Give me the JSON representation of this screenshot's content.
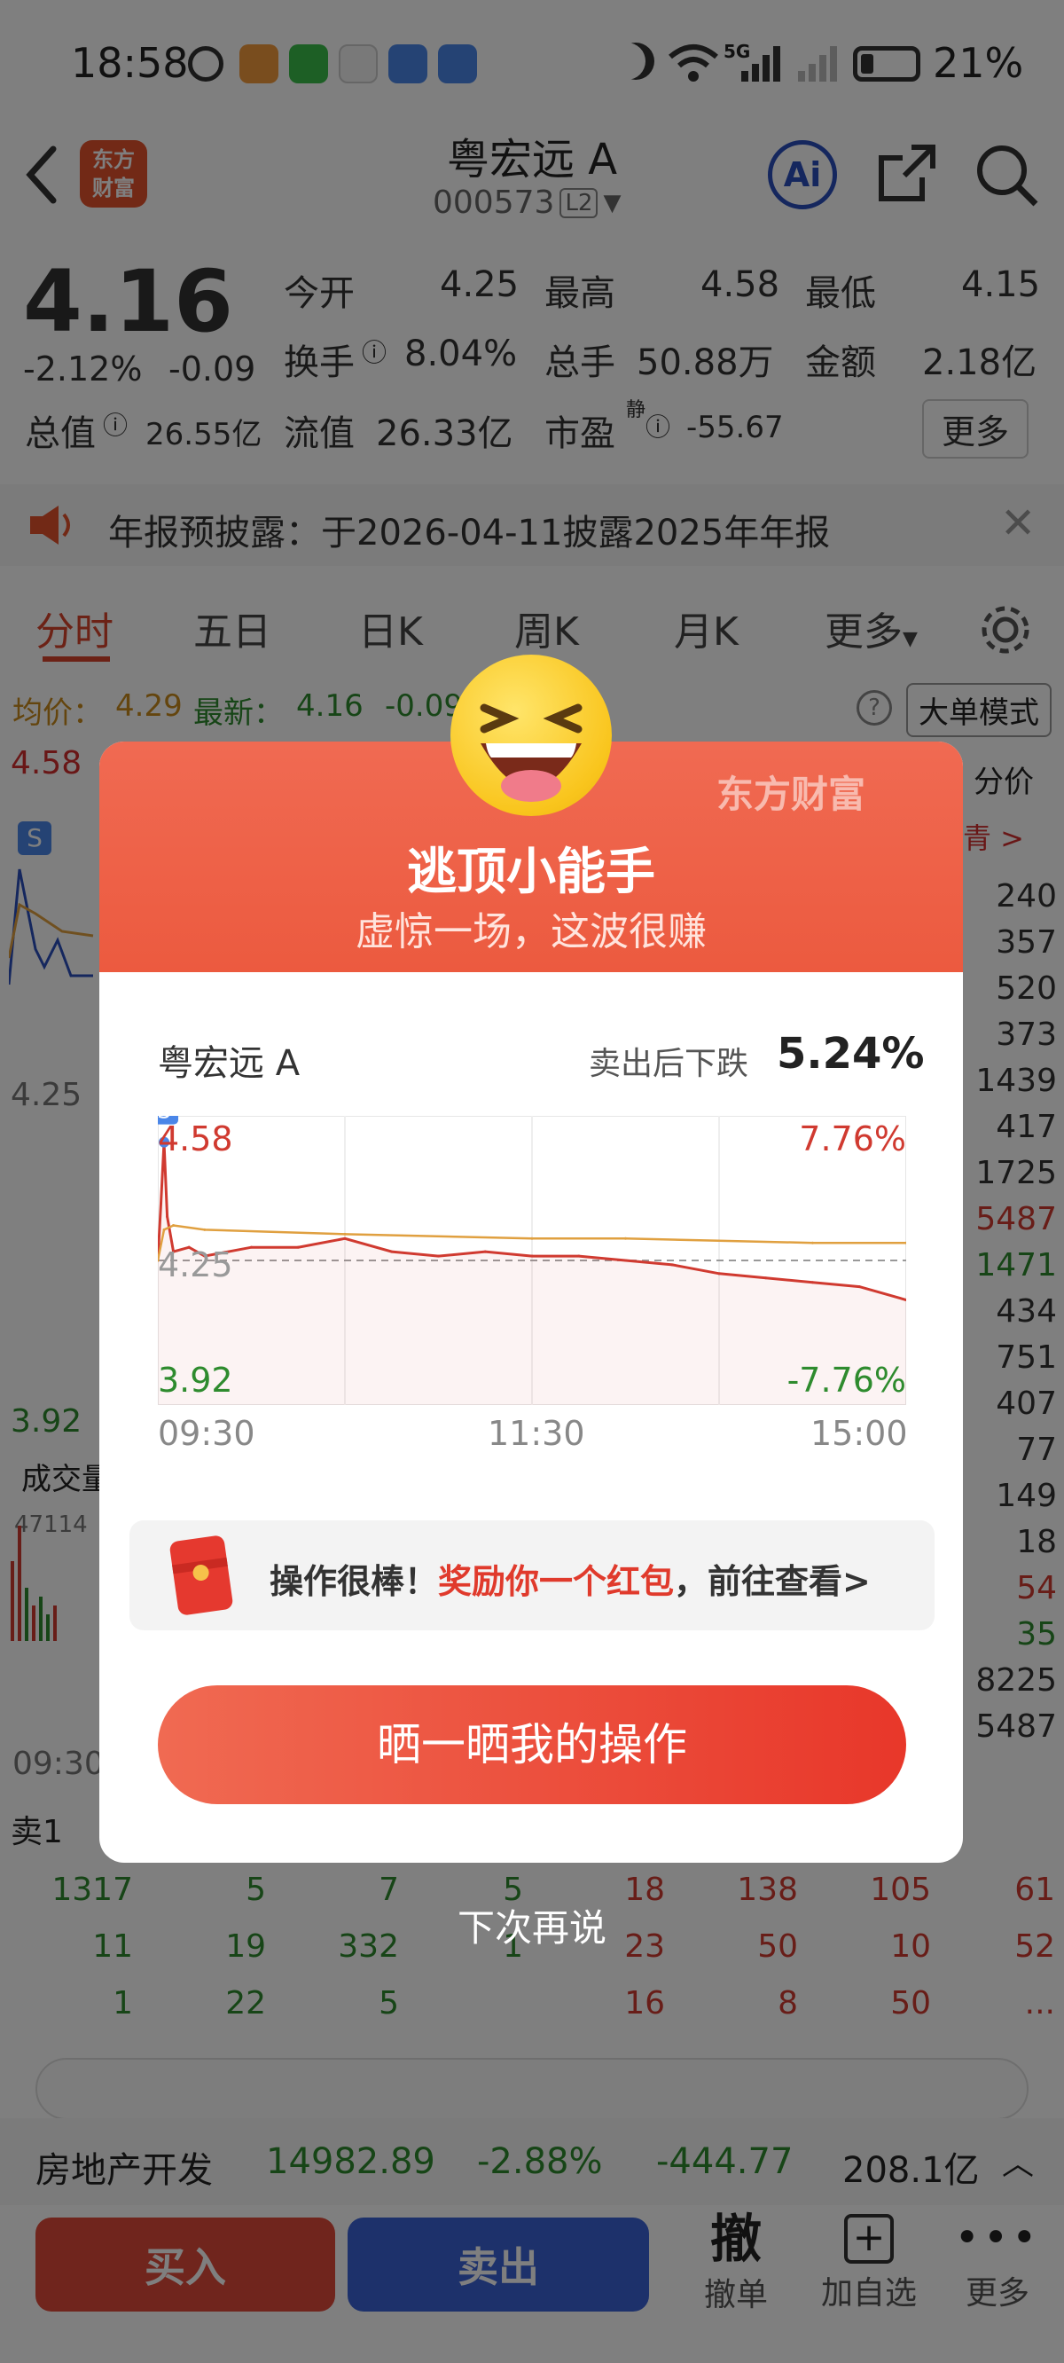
{
  "status_bar": {
    "time": "18:58",
    "network": "5G",
    "battery": "21%"
  },
  "header": {
    "stock_name": "粤宏远 A",
    "stock_code": "000573",
    "level": "L2",
    "ai_label": "Ai"
  },
  "quote": {
    "price": "4.16",
    "change_pct": "-2.12%",
    "change": "-0.09",
    "open_label": "今开",
    "open": "4.25",
    "high_label": "最高",
    "high": "4.58",
    "low_label": "最低",
    "low": "4.15",
    "turnover_label": "换手",
    "turnover": "8.04%",
    "volume_label": "总手",
    "volume": "50.88万",
    "amount_label": "金额",
    "amount": "2.18亿",
    "mktcap_label": "总值",
    "mktcap": "26.55亿",
    "float_label": "流值",
    "float": "26.33亿",
    "pe_label": "市盈",
    "pe_sup": "静",
    "pe": "-55.67",
    "more": "更多"
  },
  "notice": {
    "text": "年报预披露：于2026-04-11披露2025年年报"
  },
  "tabs": [
    "分时",
    "五日",
    "日K",
    "周K",
    "月K",
    "更多"
  ],
  "chart_header": {
    "avg_label": "均价：",
    "avg": "4.29",
    "last_label": "最新：",
    "last": "4.16",
    "chg": "-0.09",
    "mode": "大单模式"
  },
  "bg_chart": {
    "top": "4.58",
    "mid": "4.25",
    "bottom": "3.92",
    "vol_label": "成交量",
    "vol_max": "47114",
    "time_start": "09:30",
    "sell_label": "卖1",
    "right_header": "分价",
    "right_link": "青 >"
  },
  "right_list": [
    "240",
    "357",
    "520",
    "373",
    "1439",
    "417",
    "1725",
    "5487",
    "1471",
    "434",
    "751",
    "407",
    "77",
    "149",
    "18",
    "54",
    "35",
    "8225",
    "5487"
  ],
  "order_rows": [
    [
      "1317",
      "5",
      "7",
      "5",
      "18",
      "138",
      "105",
      "61"
    ],
    [
      "11",
      "19",
      "332",
      "1",
      "23",
      "50",
      "10",
      "52"
    ],
    [
      "1",
      "22",
      "5",
      "",
      "16",
      "8",
      "50",
      "..."
    ]
  ],
  "sector_bar": {
    "name": "房地产开发",
    "index": "14982.89",
    "pct": "-2.88%",
    "chg": "-444.77",
    "amount": "208.1亿"
  },
  "bottom_bar": {
    "buy": "买入",
    "sell": "卖出",
    "cancel_icon": "撤",
    "cancel": "撤单",
    "add": "加自选",
    "more": "更多"
  },
  "dialog": {
    "brand": "东方财富",
    "title": "逃顶小能手",
    "subtitle": "虚惊一场，这波很赚",
    "stock_name": "粤宏远 A",
    "drop_label": "卖出后下跌",
    "drop_value": "5.24%",
    "reward_prefix": "操作很棒！",
    "reward_highlight": "奖励你一个红包",
    "reward_suffix": "，前往查看>",
    "share_button": "晒一晒我的操作",
    "dismiss": "下次再说"
  },
  "chart_data": {
    "type": "line",
    "title": "",
    "x_ticks": [
      "09:30",
      "11:30",
      "15:00"
    ],
    "y_left_labels": {
      "top": "4.58",
      "mid": "4.25",
      "bottom": "3.92"
    },
    "y_right_labels": {
      "top": "7.76%",
      "bottom": "-7.76%"
    },
    "ylim": [
      3.92,
      4.58
    ],
    "reference": 4.25,
    "sell_marker": {
      "label": "S",
      "x": "09:32",
      "y": 4.52
    },
    "series": [
      {
        "color": "#d03a30",
        "x": [
          "09:30",
          "09:31",
          "09:32",
          "09:33",
          "09:35",
          "09:40",
          "09:45",
          "10:00",
          "10:15",
          "10:30",
          "10:45",
          "11:00",
          "11:15",
          "11:30",
          "13:15",
          "13:30",
          "13:45",
          "14:00",
          "14:15",
          "14:30",
          "14:45",
          "15:00"
        ],
        "values": [
          4.25,
          4.38,
          4.52,
          4.35,
          4.27,
          4.28,
          4.26,
          4.28,
          4.28,
          4.3,
          4.27,
          4.26,
          4.27,
          4.26,
          4.26,
          4.25,
          4.24,
          4.22,
          4.21,
          4.2,
          4.19,
          4.16
        ]
      },
      {
        "color": "#e0a040",
        "x": [
          "09:30",
          "09:32",
          "09:35",
          "09:45",
          "10:30",
          "11:30",
          "13:30",
          "14:30",
          "15:00"
        ],
        "values": [
          4.25,
          4.32,
          4.33,
          4.32,
          4.31,
          4.3,
          4.3,
          4.29,
          4.29
        ]
      }
    ]
  }
}
